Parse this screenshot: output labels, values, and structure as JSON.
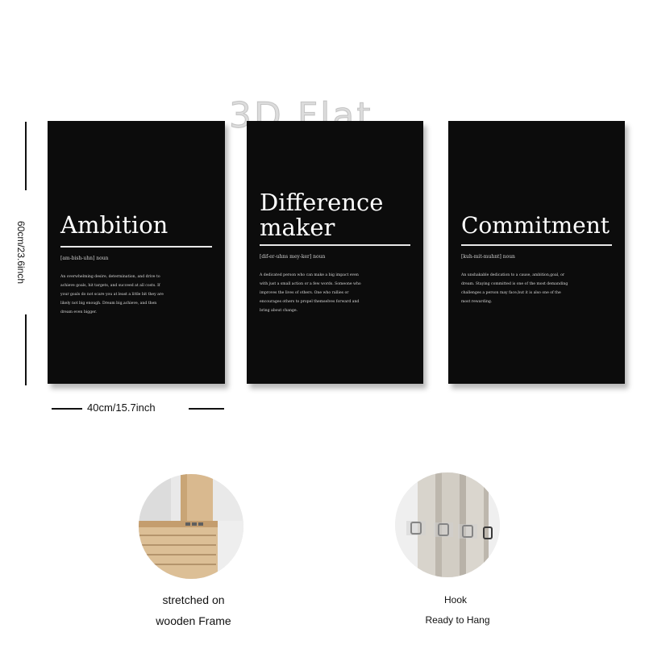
{
  "watermark": "3D Flat",
  "dimensions": {
    "height_label": "60cm/23.6inch",
    "width_label": "40cm/15.7inch"
  },
  "posters": [
    {
      "title": "Ambition",
      "pronunciation": "[am-bish-uhn] noun",
      "definition_lines": [
        "An overwhelming desire, determination, and drive to",
        "achieve goals, hit targets, and succeed at all costs. If",
        "your goals do not scare you at least a little bit they are",
        "likely not big enough. Dream big,achieve, and then",
        "dream even bigger."
      ]
    },
    {
      "title_lines": [
        "Difference",
        "maker"
      ],
      "pronunciation": "[dif-er-uhns mey-ker] noun",
      "definition_lines": [
        "A dedicated person who can make a big impact even",
        "with just a small action or a few words. Someone who",
        "improves the lives of others. One who rallies or",
        "encourages others to propel themselves forward and",
        "bring about change."
      ]
    },
    {
      "title": "Commitment",
      "pronunciation": "[kuh-mit-muhnt] noun",
      "definition_lines": [
        "An unshakable dedication to a cause, ambition,goal, or",
        "dream. Staying committed is one of the most demanding",
        "challenges a person may face,but it is also one of the",
        "most rewarding."
      ]
    }
  ],
  "features": {
    "frame_caption_lines": [
      "stretched on",
      "wooden Frame"
    ],
    "hook_caption": "Hook",
    "hook_subcaption": "Ready to Hang"
  },
  "colors": {
    "poster_bg": "#0c0c0c",
    "poster_text": "#ffffff",
    "wood": "#d9b98f"
  }
}
